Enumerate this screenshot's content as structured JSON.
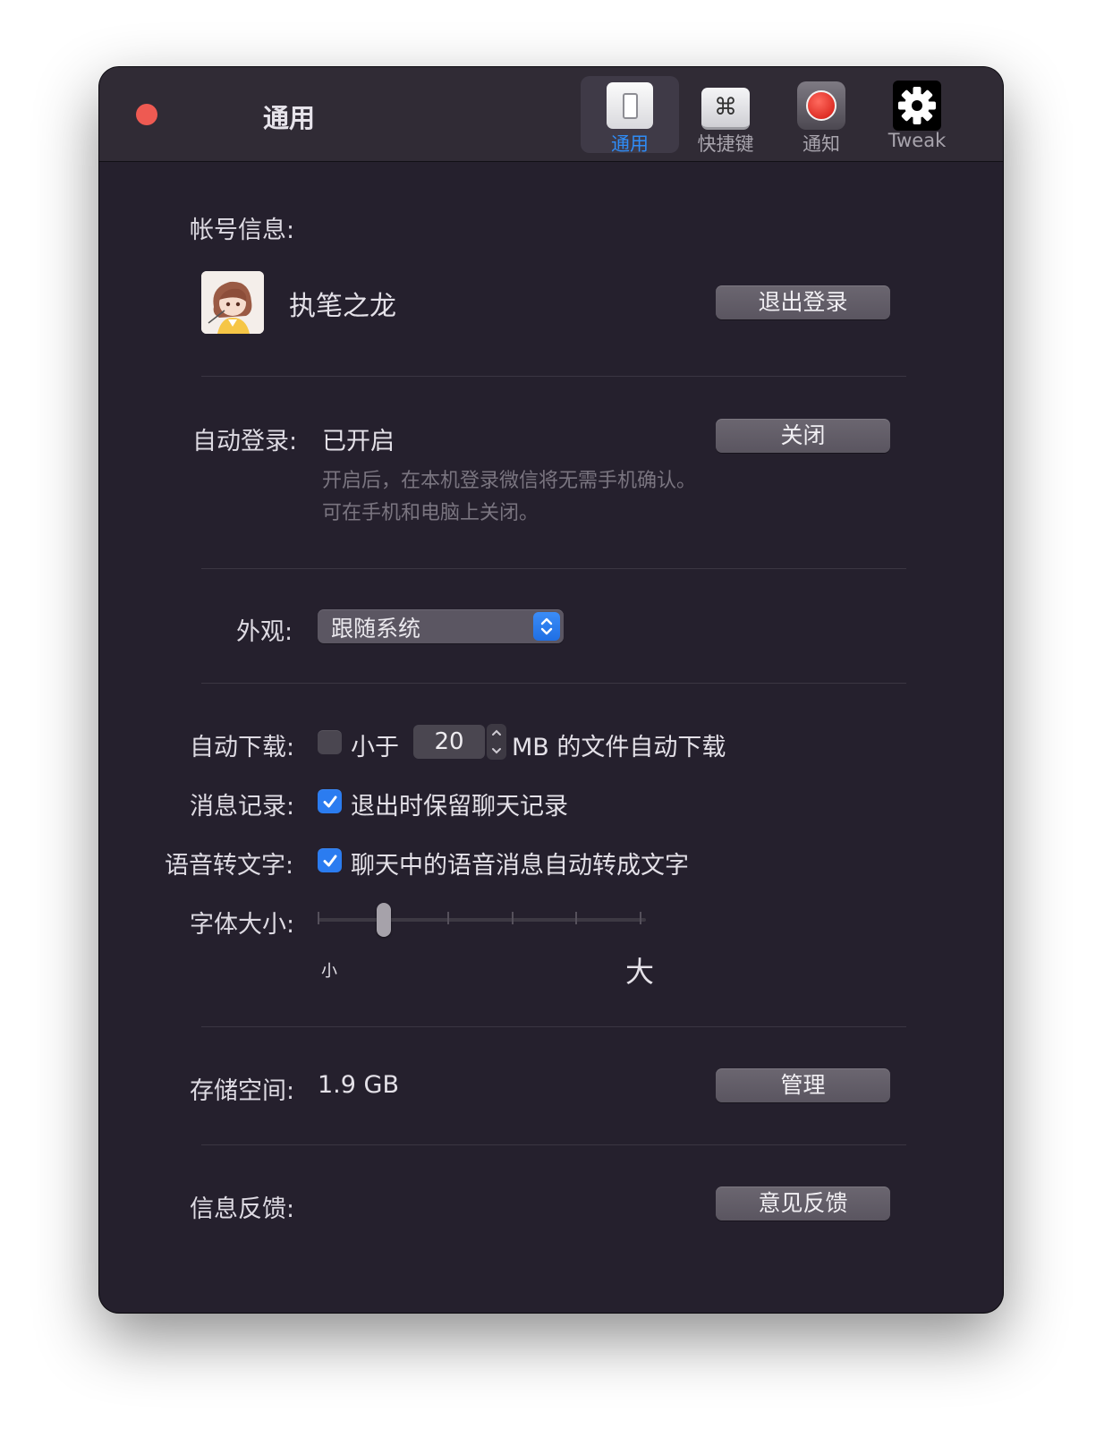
{
  "window": {
    "title": "通用"
  },
  "toolbar": {
    "items": [
      {
        "label": "通用",
        "icon": "toggle-switch-icon",
        "active": true
      },
      {
        "label": "快捷键",
        "icon": "command-key-icon",
        "active": false
      },
      {
        "label": "通知",
        "icon": "record-dot-icon",
        "active": false
      },
      {
        "label": "Tweak",
        "icon": "gear-icon",
        "active": false
      }
    ],
    "command_glyph": "⌘"
  },
  "account": {
    "label": "帐号信息:",
    "username": "执笔之龙",
    "logout_button": "退出登录"
  },
  "auto_login": {
    "label": "自动登录:",
    "status": "已开启",
    "button": "关闭",
    "hint_line1": "开启后，在本机登录微信将无需手机确认。",
    "hint_line2": "可在手机和电脑上关闭。"
  },
  "appearance": {
    "label": "外观:",
    "selected": "跟随系统"
  },
  "auto_download": {
    "label": "自动下载:",
    "checked": false,
    "prefix": "小于",
    "size_value": "20",
    "suffix": "MB 的文件自动下载"
  },
  "message_history": {
    "label": "消息记录:",
    "checked": true,
    "text": "退出时保留聊天记录"
  },
  "voice_to_text": {
    "label": "语音转文字:",
    "checked": true,
    "text": "聊天中的语音消息自动转成文字"
  },
  "font_size": {
    "label": "字体大小:",
    "min_label": "小",
    "max_label": "大",
    "steps": 6,
    "value_index": 1
  },
  "storage": {
    "label": "存储空间:",
    "value": "1.9 GB",
    "button": "管理"
  },
  "feedback": {
    "label": "信息反馈:",
    "button": "意见反馈"
  },
  "colors": {
    "window_bg": "#25202d",
    "titlebar_bg": "#302b35",
    "accent": "#2f8cf6",
    "close_button": "#ee5a52"
  }
}
